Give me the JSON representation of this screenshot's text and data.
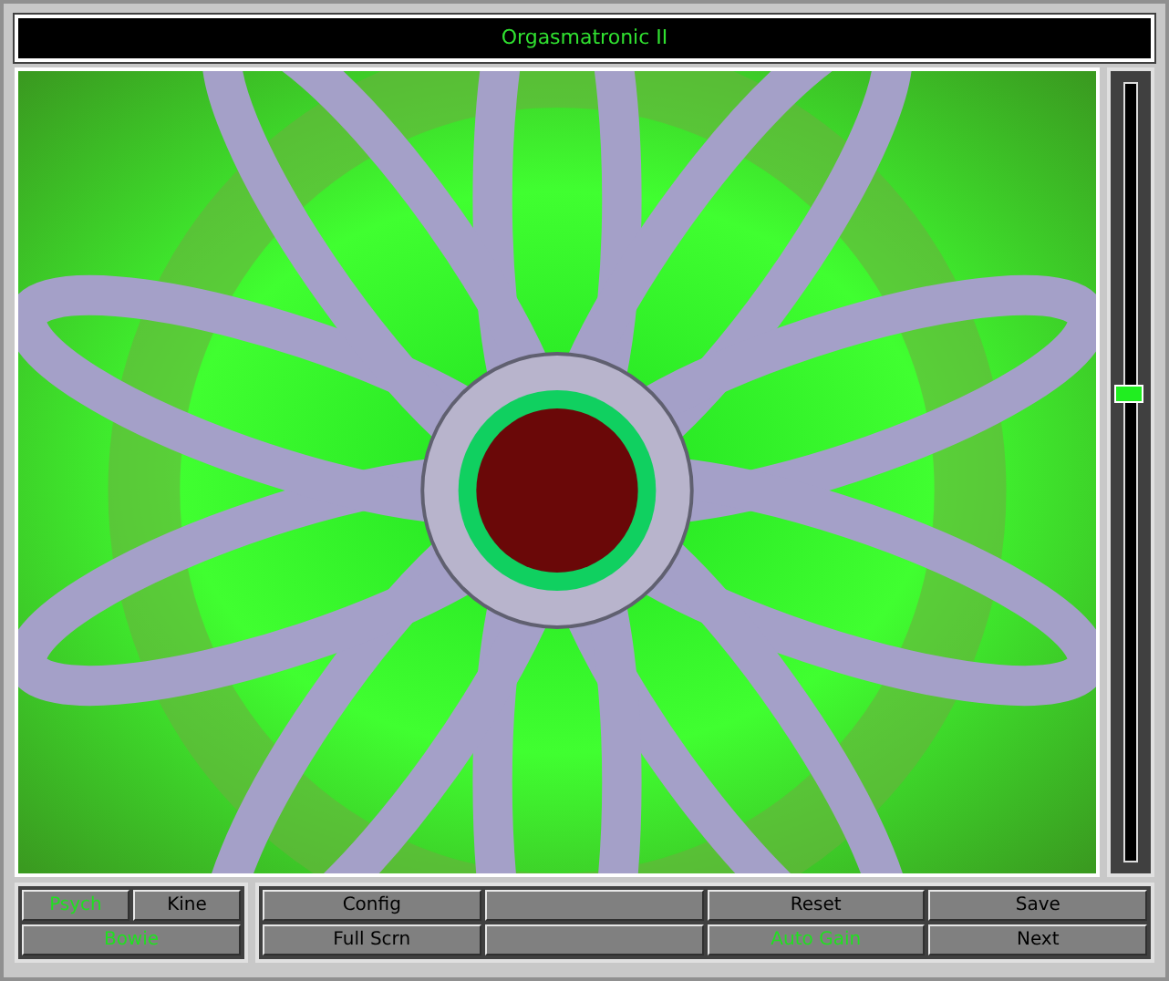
{
  "window": {
    "title": "Orgasmatronic II"
  },
  "slider": {
    "level": 0.6
  },
  "mode_buttons": [
    {
      "label": "Psych",
      "on": true
    },
    {
      "label": "Kine",
      "on": false
    },
    {
      "label": "Bowie",
      "on": true
    }
  ],
  "buttons": [
    {
      "kind": "text",
      "label": "Config",
      "on": false
    },
    {
      "kind": "blank"
    },
    {
      "kind": "text",
      "label": "Reset",
      "on": false
    },
    {
      "kind": "text",
      "label": "Save",
      "on": false
    },
    {
      "kind": "text",
      "label": "Full Scrn",
      "on": false
    },
    {
      "kind": "blank"
    },
    {
      "kind": "text",
      "label": "Auto Gain",
      "on": true
    },
    {
      "kind": "text",
      "label": "Next",
      "on": false
    }
  ]
}
